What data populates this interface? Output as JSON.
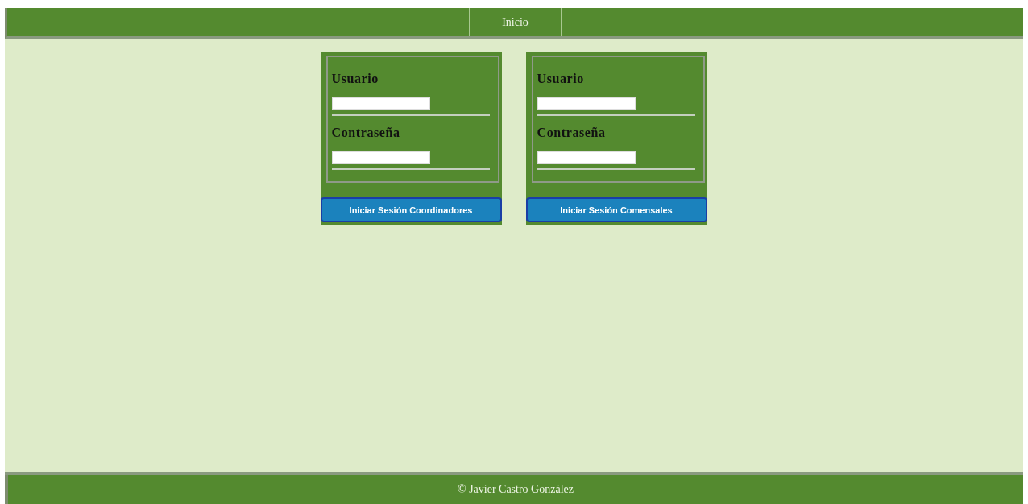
{
  "nav": {
    "items": [
      {
        "label": "Inicio"
      }
    ]
  },
  "forms": [
    {
      "fields": [
        {
          "label": "Usuario"
        },
        {
          "label": "Contraseña"
        }
      ],
      "button": "Iniciar Sesión Coordinadores"
    },
    {
      "fields": [
        {
          "label": "Usuario"
        },
        {
          "label": "Contraseña"
        }
      ],
      "button": "Iniciar Sesión Comensales"
    }
  ],
  "footer": "© Javier Castro González"
}
